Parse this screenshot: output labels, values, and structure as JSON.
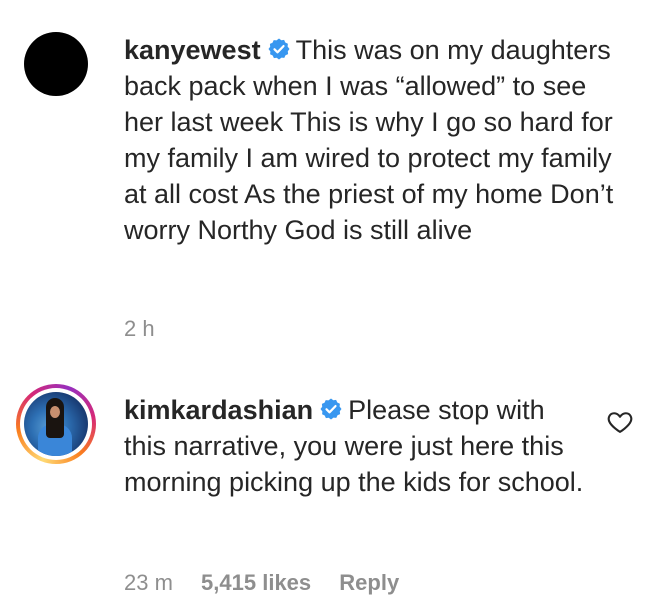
{
  "comments": [
    {
      "username": "kanyewest",
      "verified": true,
      "text": "This was on my daughters back pack when I was “allowed” to see her last week This is why I go so hard for my family I am wired to protect my family at all cost As the priest of my home Don’t worry Northy God is still alive",
      "time": "2 h"
    },
    {
      "username": "kimkardashian",
      "verified": true,
      "text": "Please stop with this narrative, you were just here this morning picking up the kids for school.",
      "time": "23 m",
      "likes": "5,415 likes",
      "reply_label": "Reply"
    }
  ],
  "icons": {
    "verified": "verified-badge-icon",
    "like": "heart-icon"
  },
  "colors": {
    "verified_blue": "#3897f0",
    "text": "#262626",
    "meta_gray": "#8e8e8e"
  }
}
